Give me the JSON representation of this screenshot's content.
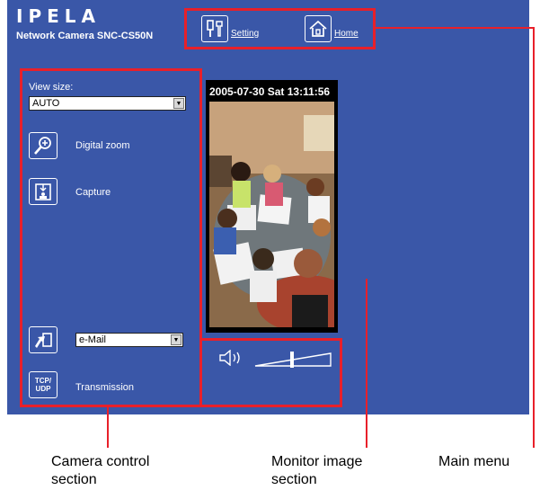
{
  "header": {
    "logo": "IPELA",
    "model": "Network Camera SNC-CS50N"
  },
  "main_menu": {
    "setting_label": "Setting",
    "home_label": "Home"
  },
  "camera_control": {
    "view_size_label": "View size:",
    "view_size_value": "AUTO",
    "digital_zoom_label": "Digital zoom",
    "capture_label": "Capture",
    "send_option_value": "e-Mail",
    "transmission_label": "Transmission",
    "tcp_udp_icon_text": "TCP/UDP"
  },
  "monitor": {
    "timestamp": "2005-07-30 Sat 13:11:56",
    "volume_level": 0.5
  },
  "annotations": {
    "camera_control_line1": "Camera control",
    "camera_control_line2": "section",
    "monitor_line1": "Monitor image",
    "monitor_line2": "section",
    "main_menu": "Main menu"
  },
  "colors": {
    "background": "#3a57a8",
    "callout": "#e8202a"
  },
  "icons": [
    "setting-icon",
    "home-icon",
    "zoom-icon",
    "capture-icon",
    "send-icon",
    "tcp-udp-icon",
    "speaker-icon",
    "chevron-down-icon"
  ]
}
